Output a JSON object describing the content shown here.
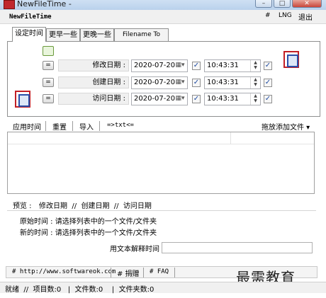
{
  "window": {
    "title": "NewFileTime -",
    "min_label": "–",
    "max_label": "□",
    "close_label": "✕"
  },
  "menubar": {
    "app_name": "NewFileTime",
    "hash": "#",
    "lng": "LNG",
    "exit": "退出"
  },
  "tabs": [
    {
      "label": "设定时间"
    },
    {
      "label": "更早一些"
    },
    {
      "label": "更晚一些"
    },
    {
      "label": "Filename To Time"
    }
  ],
  "rows": [
    {
      "btn": "=",
      "label": "修改日期 :",
      "date": "2020-07-20",
      "time": "10:43:31"
    },
    {
      "btn": "=",
      "label": "创建日期 :",
      "date": "2020-07-20",
      "time": "10:43:31"
    },
    {
      "btn": "=",
      "label": "访问日期 :",
      "date": "2020-07-20",
      "time": "10:43:31"
    }
  ],
  "actions": {
    "apply": "应用时间",
    "reset": "重置",
    "import": "导入",
    "txt": "=>txt<=",
    "drag_add": "拖放添加文件 ▾"
  },
  "preview": {
    "label": "预览 :",
    "items": "修改日期  //  创建日期  //  访问日期"
  },
  "info": {
    "original": "原始时间 : 请选择列表中的一个文件/文件夹",
    "new": "新的时间 : 请选择列表中的一个文件/文件夹",
    "text_format_label": "用文本解释时间"
  },
  "footer": {
    "site": "# http://www.softwareok.com",
    "donate": "# 捐赠",
    "faq": "# FAQ"
  },
  "status": {
    "text": "就绪  //  项目数:0   |  文件数:0    |  文件夹数:0"
  },
  "watermark": "最需教育"
}
